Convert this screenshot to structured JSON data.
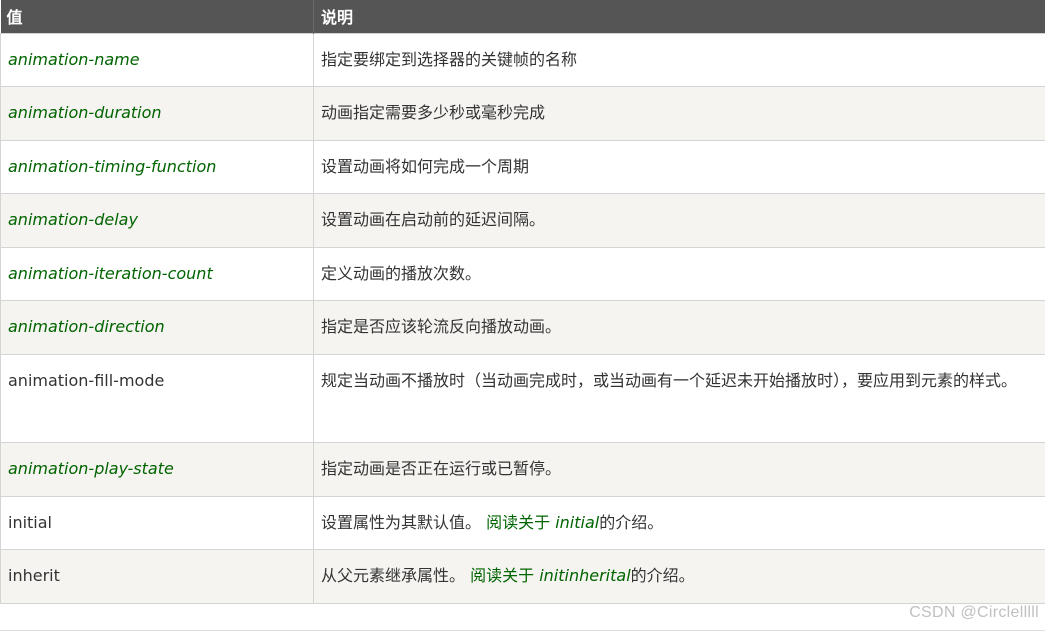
{
  "table": {
    "headers": [
      "值",
      "说明"
    ],
    "rows": [
      {
        "value": "animation-name",
        "value_style": "italic-green",
        "description": "指定要绑定到选择器的关键帧的名称"
      },
      {
        "value": "animation-duration",
        "value_style": "italic-green",
        "description": "动画指定需要多少秒或毫秒完成"
      },
      {
        "value": "animation-timing-function",
        "value_style": "italic-green",
        "description": "设置动画将如何完成一个周期"
      },
      {
        "value": "animation-delay",
        "value_style": "italic-green",
        "description": "设置动画在启动前的延迟间隔。"
      },
      {
        "value": "animation-iteration-count",
        "value_style": "italic-green",
        "description": "定义动画的播放次数。"
      },
      {
        "value": "animation-direction",
        "value_style": "italic-green",
        "description": "指定是否应该轮流反向播放动画。"
      },
      {
        "value": "animation-fill-mode",
        "value_style": "plain",
        "description": "规定当动画不播放时（当动画完成时，或当动画有一个延迟未开始播放时），要应用到元素的样式。"
      },
      {
        "value": "animation-play-state",
        "value_style": "italic-green",
        "description": "指定动画是否正在运行或已暂停。"
      },
      {
        "value": "initial",
        "value_style": "plain",
        "description": "设置属性为其默认值。",
        "link_text": "阅读关于",
        "link_term": "initial",
        "link_suffix": "的介绍。"
      },
      {
        "value": "inherit",
        "value_style": "plain",
        "description": "从父元素继承属性。",
        "link_text": "阅读关于",
        "link_term": "initinherital",
        "link_suffix": "的介绍。"
      }
    ]
  },
  "watermark": "CSDN @Circlelllll",
  "colors": {
    "header_bg": "#555555",
    "header_text": "#ffffff",
    "property_text": "#006400",
    "row_alt_bg": "#f6f4f0",
    "border": "#d4d4d4"
  }
}
